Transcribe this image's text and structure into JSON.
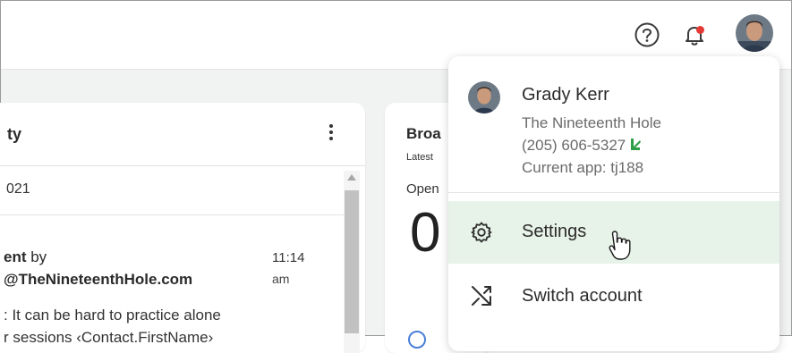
{
  "header": {
    "help_icon": "question-circle-icon",
    "notification_icon": "bell-icon",
    "notification_badge_color": "#e53935"
  },
  "activity_card": {
    "title": "ty",
    "date": "021",
    "item": {
      "line1_bold": "ent",
      "line1_rest": " by",
      "sender": "@TheNineteenthHole.com",
      "time_line1": "11:14",
      "time_line2": "am",
      "preview_line1": ": It can be hard to practice alone",
      "preview_line2": "r sessions ‹Contact.FirstName›"
    }
  },
  "broadcast_card": {
    "title": "Broa",
    "subtitle": "Latest",
    "open_label": "Open",
    "big_value": "0"
  },
  "account_menu": {
    "name": "Grady Kerr",
    "company": "The Nineteenth Hole",
    "phone": "(205) 606-5327",
    "current_app": "Current app: tj188",
    "items": [
      {
        "label": "Settings",
        "icon": "gear-icon"
      },
      {
        "label": "Switch account",
        "icon": "switch-arrows-icon"
      }
    ],
    "accent_color": "#2e9e44",
    "highlight_bg": "#e7f2e8"
  }
}
